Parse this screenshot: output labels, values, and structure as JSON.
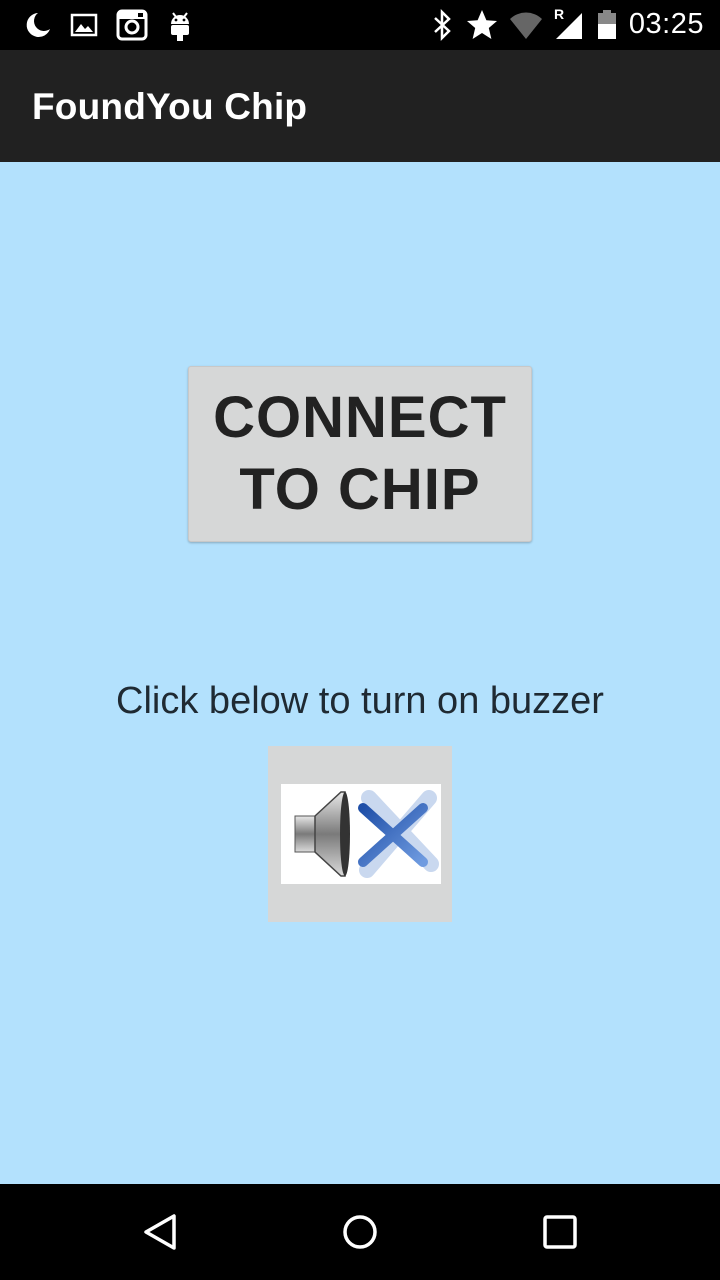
{
  "status_bar": {
    "time": "03:25",
    "network_badge": "R",
    "icons": [
      "moon-icon",
      "image-icon",
      "instagram-icon",
      "android-icon",
      "bluetooth-icon",
      "star-icon",
      "wifi-icon",
      "cell-signal-icon",
      "battery-icon"
    ]
  },
  "app_bar": {
    "title": "FoundYou Chip"
  },
  "main": {
    "connect_button": {
      "line1": "CONNECT",
      "line2": "TO CHIP"
    },
    "buzzer_label": "Click below to turn on buzzer",
    "buzzer_button": {
      "icon": "speaker-muted-icon"
    }
  },
  "nav_bar": {
    "icons": [
      "back-icon",
      "home-icon",
      "recents-icon"
    ]
  },
  "colors": {
    "background": "#b3e1fd",
    "app_bar": "#212121",
    "button": "#d6d7d7",
    "status_bar": "#000000"
  }
}
